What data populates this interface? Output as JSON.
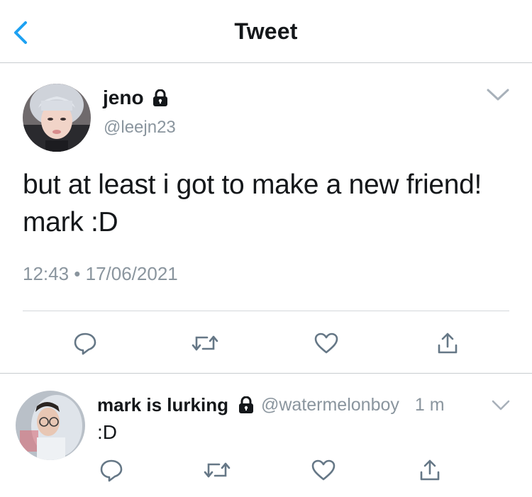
{
  "header": {
    "title": "Tweet",
    "back_icon": "chevron-left-icon",
    "accent_color": "#1da1f2"
  },
  "tweet": {
    "name": "jeno",
    "handle": "@leejn23",
    "protected_icon": "lock-icon",
    "text": "but at least i got to make a new friend! mark :D",
    "timestamp": "12:43 • 17/06/2021",
    "menu_icon": "chevron-down-icon"
  },
  "actions": {
    "icons": [
      "reply-icon",
      "retweet-icon",
      "like-icon",
      "share-icon"
    ],
    "color": "#657786"
  },
  "reply": {
    "name": "mark is lurking",
    "handle": "@watermelonboy",
    "time": "1 m",
    "text": ":D",
    "protected_icon": "lock-icon",
    "menu_icon": "chevron-down-icon"
  }
}
